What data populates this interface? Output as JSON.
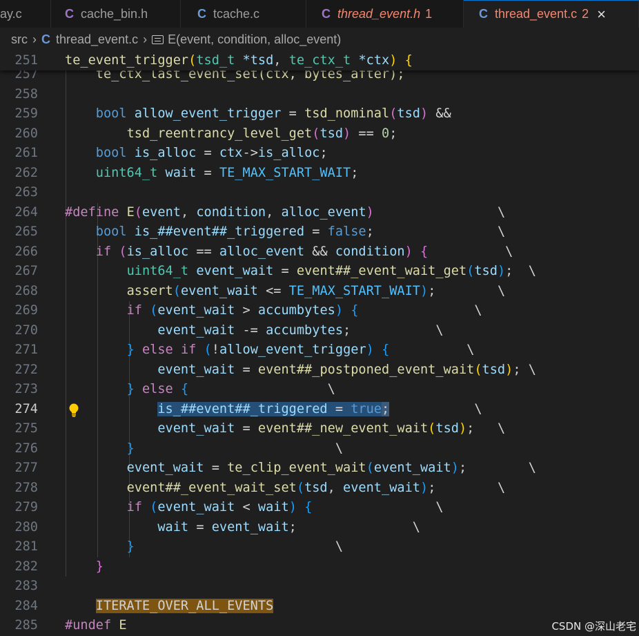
{
  "tabs": [
    {
      "title": "ay.c",
      "kind": "c",
      "italic": false,
      "badge": "",
      "active": false,
      "modified": false,
      "close": ""
    },
    {
      "title": "cache_bin.h",
      "kind": "h",
      "italic": false,
      "badge": "",
      "active": false,
      "modified": false,
      "close": ""
    },
    {
      "title": "tcache.c",
      "kind": "c",
      "italic": false,
      "badge": "",
      "active": false,
      "modified": false,
      "close": ""
    },
    {
      "title": "thread_event.h",
      "kind": "h",
      "italic": true,
      "badge": "1",
      "active": false,
      "modified": true,
      "close": ""
    },
    {
      "title": "thread_event.c",
      "kind": "c",
      "italic": false,
      "badge": "2",
      "active": true,
      "modified": true,
      "close": "×"
    }
  ],
  "breadcrumb": {
    "folder": "src",
    "file_icon": "C",
    "file": "thread_event.c",
    "symbol": "E(event, condition, alloc_event)"
  },
  "sticky_scroll": {
    "line_number": "251",
    "tokens": [
      {
        "t": "te_event_trigger",
        "c": "fn"
      },
      {
        "t": "(",
        "c": "br1"
      },
      {
        "t": "tsd_t",
        "c": "ty"
      },
      {
        "t": " ",
        "c": "op"
      },
      {
        "t": "*tsd",
        "c": "var"
      },
      {
        "t": ", ",
        "c": "pun"
      },
      {
        "t": "te_ctx_t",
        "c": "ty"
      },
      {
        "t": " ",
        "c": "op"
      },
      {
        "t": "*ctx",
        "c": "var"
      },
      {
        "t": ")",
        "c": "br1"
      },
      {
        "t": " ",
        "c": "op"
      },
      {
        "t": "{",
        "c": "br1"
      }
    ]
  },
  "code_lines": [
    {
      "n": "257",
      "tokens": [
        {
          "t": "    te_ctx_last_event_set(ctx, bytes_after);",
          "c": "fn"
        }
      ]
    },
    {
      "n": "258",
      "tokens": []
    },
    {
      "n": "259",
      "tokens": [
        {
          "t": "    ",
          "c": "op"
        },
        {
          "t": "bool",
          "c": "kw"
        },
        {
          "t": " ",
          "c": "op"
        },
        {
          "t": "allow_event_trigger",
          "c": "var"
        },
        {
          "t": " = ",
          "c": "op"
        },
        {
          "t": "tsd_nominal",
          "c": "fn"
        },
        {
          "t": "(",
          "c": "br2"
        },
        {
          "t": "tsd",
          "c": "var"
        },
        {
          "t": ")",
          "c": "br2"
        },
        {
          "t": " &&",
          "c": "op"
        }
      ]
    },
    {
      "n": "260",
      "tokens": [
        {
          "t": "        ",
          "c": "op"
        },
        {
          "t": "tsd_reentrancy_level_get",
          "c": "fn"
        },
        {
          "t": "(",
          "c": "br2"
        },
        {
          "t": "tsd",
          "c": "var"
        },
        {
          "t": ")",
          "c": "br2"
        },
        {
          "t": " == ",
          "c": "op"
        },
        {
          "t": "0",
          "c": "num"
        },
        {
          "t": ";",
          "c": "pun"
        }
      ]
    },
    {
      "n": "261",
      "tokens": [
        {
          "t": "    ",
          "c": "op"
        },
        {
          "t": "bool",
          "c": "kw"
        },
        {
          "t": " ",
          "c": "op"
        },
        {
          "t": "is_alloc",
          "c": "var"
        },
        {
          "t": " = ",
          "c": "op"
        },
        {
          "t": "ctx",
          "c": "var"
        },
        {
          "t": "->",
          "c": "op"
        },
        {
          "t": "is_alloc",
          "c": "var"
        },
        {
          "t": ";",
          "c": "pun"
        }
      ]
    },
    {
      "n": "262",
      "tokens": [
        {
          "t": "    ",
          "c": "op"
        },
        {
          "t": "uint64_t",
          "c": "ty"
        },
        {
          "t": " ",
          "c": "op"
        },
        {
          "t": "wait",
          "c": "var"
        },
        {
          "t": " = ",
          "c": "op"
        },
        {
          "t": "TE_MAX_START_WAIT",
          "c": "vard"
        },
        {
          "t": ";",
          "c": "pun"
        }
      ]
    },
    {
      "n": "263",
      "tokens": []
    },
    {
      "n": "264",
      "tokens": [
        {
          "t": "#define",
          "c": "ctl"
        },
        {
          "t": " ",
          "c": "op"
        },
        {
          "t": "E",
          "c": "fn"
        },
        {
          "t": "(",
          "c": "br2"
        },
        {
          "t": "event",
          "c": "var"
        },
        {
          "t": ", ",
          "c": "pun"
        },
        {
          "t": "condition",
          "c": "var"
        },
        {
          "t": ", ",
          "c": "pun"
        },
        {
          "t": "alloc_event",
          "c": "var"
        },
        {
          "t": ")",
          "c": "br2"
        },
        {
          "t": "                \\",
          "c": "op"
        }
      ]
    },
    {
      "n": "265",
      "tokens": [
        {
          "t": "    ",
          "c": "op"
        },
        {
          "t": "bool",
          "c": "kw"
        },
        {
          "t": " ",
          "c": "op"
        },
        {
          "t": "is_##event##_triggered",
          "c": "var"
        },
        {
          "t": " = ",
          "c": "op"
        },
        {
          "t": "false",
          "c": "kw"
        },
        {
          "t": ";",
          "c": "pun"
        },
        {
          "t": "                \\",
          "c": "op"
        }
      ]
    },
    {
      "n": "266",
      "tokens": [
        {
          "t": "    ",
          "c": "op"
        },
        {
          "t": "if",
          "c": "ctl"
        },
        {
          "t": " ",
          "c": "op"
        },
        {
          "t": "(",
          "c": "br2"
        },
        {
          "t": "is_alloc",
          "c": "var"
        },
        {
          "t": " == ",
          "c": "op"
        },
        {
          "t": "alloc_event",
          "c": "var"
        },
        {
          "t": " && ",
          "c": "op"
        },
        {
          "t": "condition",
          "c": "var"
        },
        {
          "t": ")",
          "c": "br2"
        },
        {
          "t": " ",
          "c": "op"
        },
        {
          "t": "{",
          "c": "br2"
        },
        {
          "t": "          \\",
          "c": "op"
        }
      ]
    },
    {
      "n": "267",
      "tokens": [
        {
          "t": "        ",
          "c": "op"
        },
        {
          "t": "uint64_t",
          "c": "ty"
        },
        {
          "t": " ",
          "c": "op"
        },
        {
          "t": "event_wait",
          "c": "var"
        },
        {
          "t": " = ",
          "c": "op"
        },
        {
          "t": "event##_event_wait_get",
          "c": "fn"
        },
        {
          "t": "(",
          "c": "br3"
        },
        {
          "t": "tsd",
          "c": "var"
        },
        {
          "t": ")",
          "c": "br3"
        },
        {
          "t": ";",
          "c": "pun"
        },
        {
          "t": "  \\",
          "c": "op"
        }
      ]
    },
    {
      "n": "268",
      "tokens": [
        {
          "t": "        ",
          "c": "op"
        },
        {
          "t": "assert",
          "c": "fn"
        },
        {
          "t": "(",
          "c": "br3"
        },
        {
          "t": "event_wait",
          "c": "var"
        },
        {
          "t": " <= ",
          "c": "op"
        },
        {
          "t": "TE_MAX_START_WAIT",
          "c": "vard"
        },
        {
          "t": ")",
          "c": "br3"
        },
        {
          "t": ";",
          "c": "pun"
        },
        {
          "t": "        \\",
          "c": "op"
        }
      ]
    },
    {
      "n": "269",
      "tokens": [
        {
          "t": "        ",
          "c": "op"
        },
        {
          "t": "if",
          "c": "ctl"
        },
        {
          "t": " ",
          "c": "op"
        },
        {
          "t": "(",
          "c": "br3"
        },
        {
          "t": "event_wait",
          "c": "var"
        },
        {
          "t": " > ",
          "c": "op"
        },
        {
          "t": "accumbytes",
          "c": "var"
        },
        {
          "t": ")",
          "c": "br3"
        },
        {
          "t": " ",
          "c": "op"
        },
        {
          "t": "{",
          "c": "br3"
        },
        {
          "t": "               \\",
          "c": "op"
        }
      ]
    },
    {
      "n": "270",
      "tokens": [
        {
          "t": "            ",
          "c": "op"
        },
        {
          "t": "event_wait",
          "c": "var"
        },
        {
          "t": " -= ",
          "c": "op"
        },
        {
          "t": "accumbytes",
          "c": "var"
        },
        {
          "t": ";",
          "c": "pun"
        },
        {
          "t": "           \\",
          "c": "op"
        }
      ]
    },
    {
      "n": "271",
      "tokens": [
        {
          "t": "        ",
          "c": "op"
        },
        {
          "t": "}",
          "c": "br3"
        },
        {
          "t": " ",
          "c": "op"
        },
        {
          "t": "else",
          "c": "ctl"
        },
        {
          "t": " ",
          "c": "op"
        },
        {
          "t": "if",
          "c": "ctl"
        },
        {
          "t": " ",
          "c": "op"
        },
        {
          "t": "(",
          "c": "br3"
        },
        {
          "t": "!",
          "c": "op"
        },
        {
          "t": "allow_event_trigger",
          "c": "var"
        },
        {
          "t": ")",
          "c": "br3"
        },
        {
          "t": " ",
          "c": "op"
        },
        {
          "t": "{",
          "c": "br3"
        },
        {
          "t": "          \\",
          "c": "op"
        }
      ]
    },
    {
      "n": "272",
      "tokens": [
        {
          "t": "            ",
          "c": "op"
        },
        {
          "t": "event_wait",
          "c": "var"
        },
        {
          "t": " = ",
          "c": "op"
        },
        {
          "t": "event##_postponed_event_wait",
          "c": "fn"
        },
        {
          "t": "(",
          "c": "br1"
        },
        {
          "t": "tsd",
          "c": "var"
        },
        {
          "t": ")",
          "c": "br1"
        },
        {
          "t": ";",
          "c": "pun"
        },
        {
          "t": " \\",
          "c": "op"
        }
      ]
    },
    {
      "n": "273",
      "tokens": [
        {
          "t": "        ",
          "c": "op"
        },
        {
          "t": "}",
          "c": "br3"
        },
        {
          "t": " ",
          "c": "op"
        },
        {
          "t": "else",
          "c": "ctl"
        },
        {
          "t": " ",
          "c": "op"
        },
        {
          "t": "{",
          "c": "br3"
        },
        {
          "t": "                  \\",
          "c": "op"
        }
      ]
    },
    {
      "n": "274",
      "tokens": [
        {
          "t": "            ",
          "c": "op"
        },
        {
          "t": "is_##event##_triggered",
          "c": "var",
          "hl": "sel"
        },
        {
          "t": " = ",
          "c": "op",
          "hl": "sel"
        },
        {
          "t": "true",
          "c": "kw",
          "hl": "sel"
        },
        {
          "t": ";",
          "c": "pun",
          "hl": "selc"
        },
        {
          "t": "           \\",
          "c": "op"
        }
      ]
    },
    {
      "n": "275",
      "tokens": [
        {
          "t": "            ",
          "c": "op"
        },
        {
          "t": "event_wait",
          "c": "var"
        },
        {
          "t": " = ",
          "c": "op"
        },
        {
          "t": "event##_new_event_wait",
          "c": "fn"
        },
        {
          "t": "(",
          "c": "br1"
        },
        {
          "t": "tsd",
          "c": "var"
        },
        {
          "t": ")",
          "c": "br1"
        },
        {
          "t": ";",
          "c": "pun"
        },
        {
          "t": "   \\",
          "c": "op"
        }
      ]
    },
    {
      "n": "276",
      "tokens": [
        {
          "t": "        ",
          "c": "op"
        },
        {
          "t": "}",
          "c": "br3"
        },
        {
          "t": "                          \\",
          "c": "op"
        }
      ]
    },
    {
      "n": "277",
      "tokens": [
        {
          "t": "        ",
          "c": "op"
        },
        {
          "t": "event_wait",
          "c": "var"
        },
        {
          "t": " = ",
          "c": "op"
        },
        {
          "t": "te_clip_event_wait",
          "c": "fn"
        },
        {
          "t": "(",
          "c": "br3"
        },
        {
          "t": "event_wait",
          "c": "var"
        },
        {
          "t": ")",
          "c": "br3"
        },
        {
          "t": ";",
          "c": "pun"
        },
        {
          "t": "        \\",
          "c": "op"
        }
      ]
    },
    {
      "n": "278",
      "tokens": [
        {
          "t": "        ",
          "c": "op"
        },
        {
          "t": "event##_event_wait_set",
          "c": "fn"
        },
        {
          "t": "(",
          "c": "br3"
        },
        {
          "t": "tsd",
          "c": "var"
        },
        {
          "t": ", ",
          "c": "pun"
        },
        {
          "t": "event_wait",
          "c": "var"
        },
        {
          "t": ")",
          "c": "br3"
        },
        {
          "t": ";",
          "c": "pun"
        },
        {
          "t": "        \\",
          "c": "op"
        }
      ]
    },
    {
      "n": "279",
      "tokens": [
        {
          "t": "        ",
          "c": "op"
        },
        {
          "t": "if",
          "c": "ctl"
        },
        {
          "t": " ",
          "c": "op"
        },
        {
          "t": "(",
          "c": "br3"
        },
        {
          "t": "event_wait",
          "c": "var"
        },
        {
          "t": " < ",
          "c": "op"
        },
        {
          "t": "wait",
          "c": "var"
        },
        {
          "t": ")",
          "c": "br3"
        },
        {
          "t": " ",
          "c": "op"
        },
        {
          "t": "{",
          "c": "br3"
        },
        {
          "t": "                \\",
          "c": "op"
        }
      ]
    },
    {
      "n": "280",
      "tokens": [
        {
          "t": "            ",
          "c": "op"
        },
        {
          "t": "wait",
          "c": "var"
        },
        {
          "t": " = ",
          "c": "op"
        },
        {
          "t": "event_wait",
          "c": "var"
        },
        {
          "t": ";",
          "c": "pun"
        },
        {
          "t": "               \\",
          "c": "op"
        }
      ]
    },
    {
      "n": "281",
      "tokens": [
        {
          "t": "        ",
          "c": "op"
        },
        {
          "t": "}",
          "c": "br3"
        },
        {
          "t": "                          \\",
          "c": "op"
        }
      ]
    },
    {
      "n": "282",
      "tokens": [
        {
          "t": "    ",
          "c": "op"
        },
        {
          "t": "}",
          "c": "br2"
        }
      ]
    },
    {
      "n": "283",
      "tokens": []
    },
    {
      "n": "284",
      "tokens": [
        {
          "t": "    ",
          "c": "op"
        },
        {
          "t": "ITERATE_OVER_ALL_EVENTS",
          "c": "op",
          "hl": "macro-hl"
        }
      ]
    },
    {
      "n": "285",
      "tokens": [
        {
          "t": "#undef",
          "c": "ctl"
        },
        {
          "t": " ",
          "c": "op"
        },
        {
          "t": "E",
          "c": "fn"
        }
      ]
    }
  ],
  "cursor_line": "274",
  "lightbulb_line": "274",
  "watermark": "CSDN @深山老宅"
}
